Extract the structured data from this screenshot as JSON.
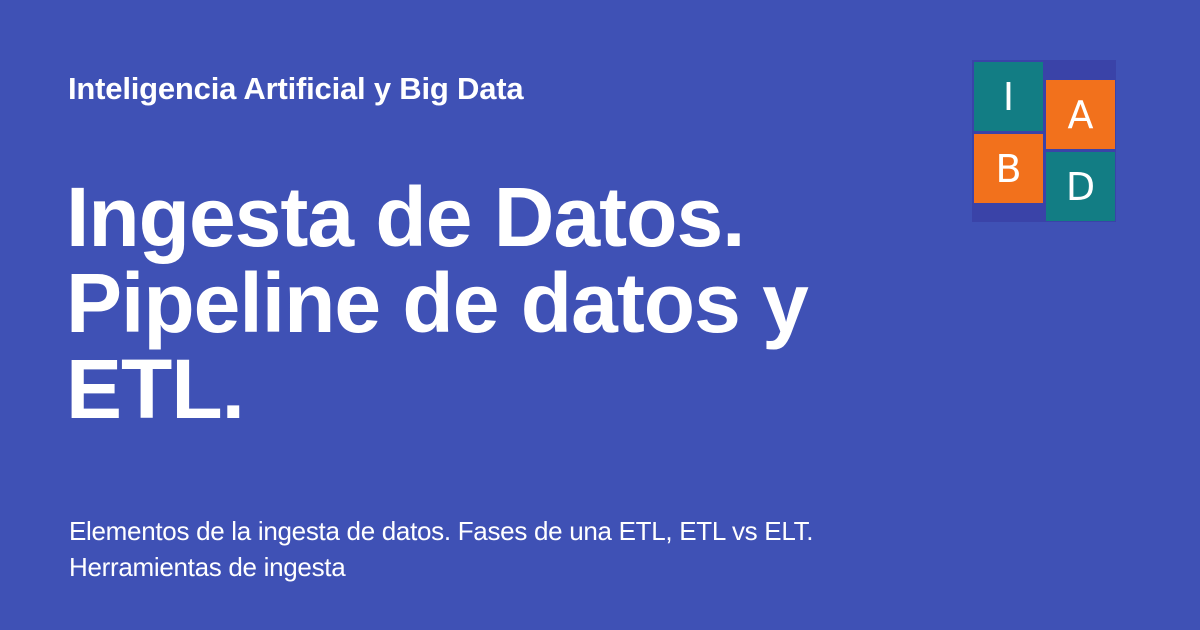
{
  "site": {
    "name": "Inteligencia Artificial y Big Data"
  },
  "title": {
    "lines": [
      "Ingesta de Datos.",
      "Pipeline de datos y",
      "ETL."
    ]
  },
  "description": {
    "lines": [
      "Elementos de la ingesta de datos. Fases de una ETL, ETL vs ELT.",
      "Herramientas de ingesta"
    ]
  },
  "logo": {
    "letters": [
      "I",
      "A",
      "B",
      "D"
    ]
  },
  "colors": {
    "background": "#3f51b5",
    "teal": "#127d84",
    "orange": "#f2711c",
    "text": "#ffffff"
  }
}
